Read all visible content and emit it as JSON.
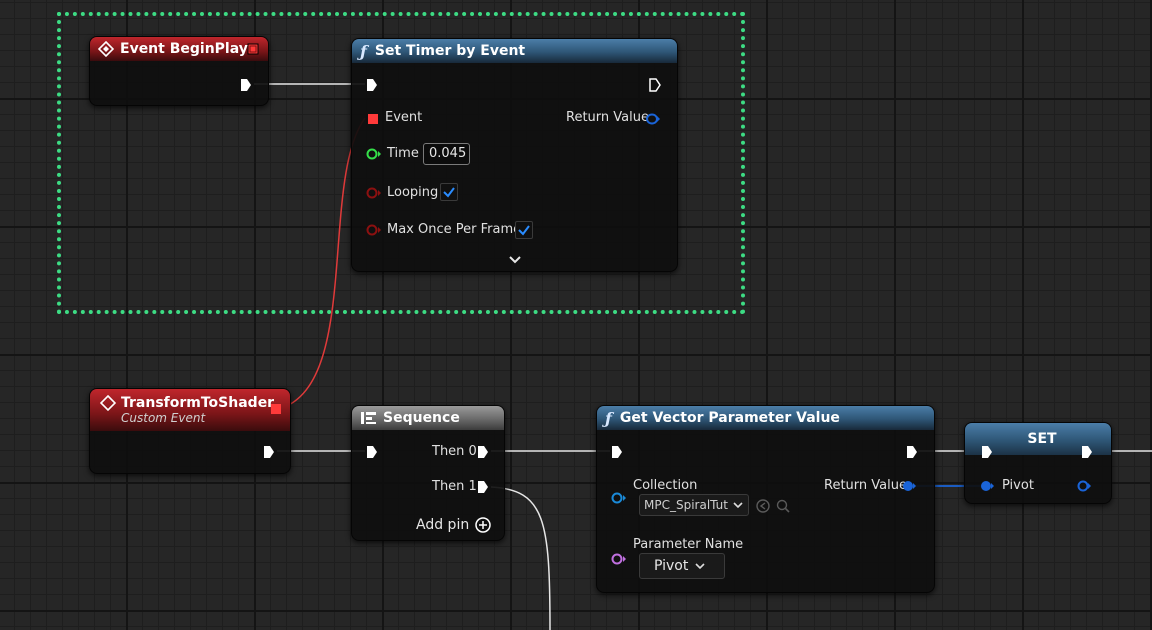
{
  "comment": {
    "color": "#3ddc84"
  },
  "event_begin_play": {
    "title": "Event BeginPlay"
  },
  "set_timer": {
    "title": "Set Timer by Event",
    "event_label": "Event",
    "return_label": "Return Value",
    "time_label": "Time",
    "time_value": "0.045",
    "looping_label": "Looping",
    "looping_checked": true,
    "max_once_label": "Max Once Per Frame",
    "max_once_checked": true
  },
  "transform_event": {
    "title": "TransformToShader",
    "subtitle": "Custom Event"
  },
  "sequence": {
    "title": "Sequence",
    "then0": "Then 0",
    "then1": "Then 1",
    "add_pin": "Add pin"
  },
  "get_vector": {
    "title": "Get Vector Parameter Value",
    "collection_label": "Collection",
    "collection_value": "MPC_SpiralTuto",
    "return_label": "Return Value",
    "param_label": "Parameter Name",
    "param_value": "Pivot"
  },
  "set_node": {
    "title": "SET",
    "pivot_label": "Pivot"
  },
  "colors": {
    "exec": "#ffffff",
    "delegate": "#ff3a3a",
    "float": "#35e04a",
    "bool": "#8c1010",
    "struct": "#1a64d8",
    "object": "#1a8ad8",
    "name": "#c070e0",
    "comment": "#3ddc84"
  },
  "icons": {
    "event": "diamond-event-icon",
    "function": "function-f-icon",
    "sequence": "sequence-icon",
    "add": "plus-circle-icon",
    "check": "checkmark-icon",
    "expand": "chevron-down-icon"
  }
}
